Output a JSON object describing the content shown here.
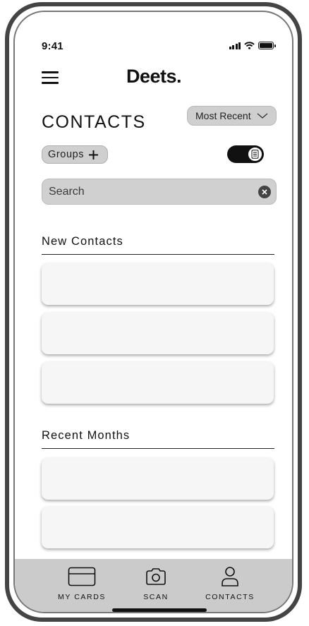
{
  "status_bar": {
    "time": "9:41"
  },
  "header": {
    "logo": "Deets."
  },
  "page": {
    "title": "CONTACTS",
    "sort_label": "Most Recent"
  },
  "filters": {
    "groups_label": "Groups"
  },
  "search": {
    "placeholder": "Search"
  },
  "sections": {
    "new_contacts": "New Contacts",
    "recent_months": "Recent Months"
  },
  "tab_bar": {
    "my_cards": "MY CARDS",
    "scan": "SCAN",
    "contacts": "CONTACTS"
  },
  "icons": {
    "menu": "hamburger-icon",
    "sort": "chevron-down-icon",
    "groups": "plus-icon",
    "toggle": "document-icon",
    "clear": "close-icon",
    "my_cards": "card-icon",
    "scan": "camera-icon",
    "contacts": "person-icon"
  },
  "colors": {
    "tab_bar_bg": "#cbcbcb",
    "chip_bg": "#cfcfcf",
    "card_bg": "#f6f6f6",
    "toggle_bg": "#111111"
  }
}
